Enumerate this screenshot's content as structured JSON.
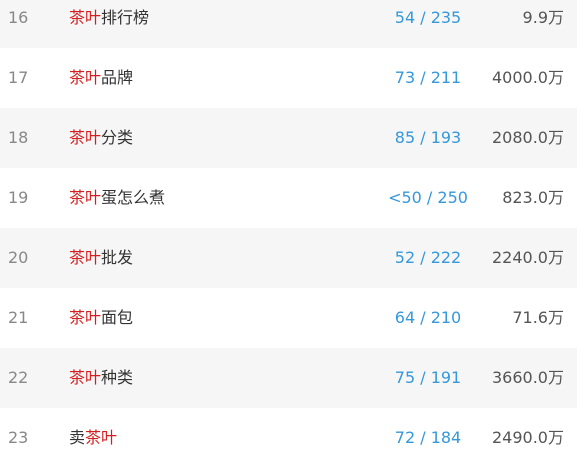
{
  "rows": [
    {
      "rank": "16",
      "keyword": [
        {
          "text": "茶叶",
          "hl": true
        },
        {
          "text": "排行榜",
          "hl": false
        }
      ],
      "ratio": "54 / 235",
      "volume": "9.9万"
    },
    {
      "rank": "17",
      "keyword": [
        {
          "text": "茶叶",
          "hl": true
        },
        {
          "text": "品牌",
          "hl": false
        }
      ],
      "ratio": "73 / 211",
      "volume": "4000.0万"
    },
    {
      "rank": "18",
      "keyword": [
        {
          "text": "茶叶",
          "hl": true
        },
        {
          "text": "分类",
          "hl": false
        }
      ],
      "ratio": "85 / 193",
      "volume": "2080.0万"
    },
    {
      "rank": "19",
      "keyword": [
        {
          "text": "茶叶",
          "hl": true
        },
        {
          "text": "蛋怎么煮",
          "hl": false
        }
      ],
      "ratio": "<50 / 250",
      "volume": "823.0万"
    },
    {
      "rank": "20",
      "keyword": [
        {
          "text": "茶叶",
          "hl": true
        },
        {
          "text": "批发",
          "hl": false
        }
      ],
      "ratio": "52 / 222",
      "volume": "2240.0万"
    },
    {
      "rank": "21",
      "keyword": [
        {
          "text": "茶叶",
          "hl": true
        },
        {
          "text": "面包",
          "hl": false
        }
      ],
      "ratio": "64 / 210",
      "volume": "71.6万"
    },
    {
      "rank": "22",
      "keyword": [
        {
          "text": "茶叶",
          "hl": true
        },
        {
          "text": "种类",
          "hl": false
        }
      ],
      "ratio": "75 / 191",
      "volume": "3660.0万"
    },
    {
      "rank": "23",
      "keyword": [
        {
          "text": "卖",
          "hl": false
        },
        {
          "text": "茶叶",
          "hl": true
        }
      ],
      "ratio": "72 / 184",
      "volume": "2490.0万"
    }
  ]
}
